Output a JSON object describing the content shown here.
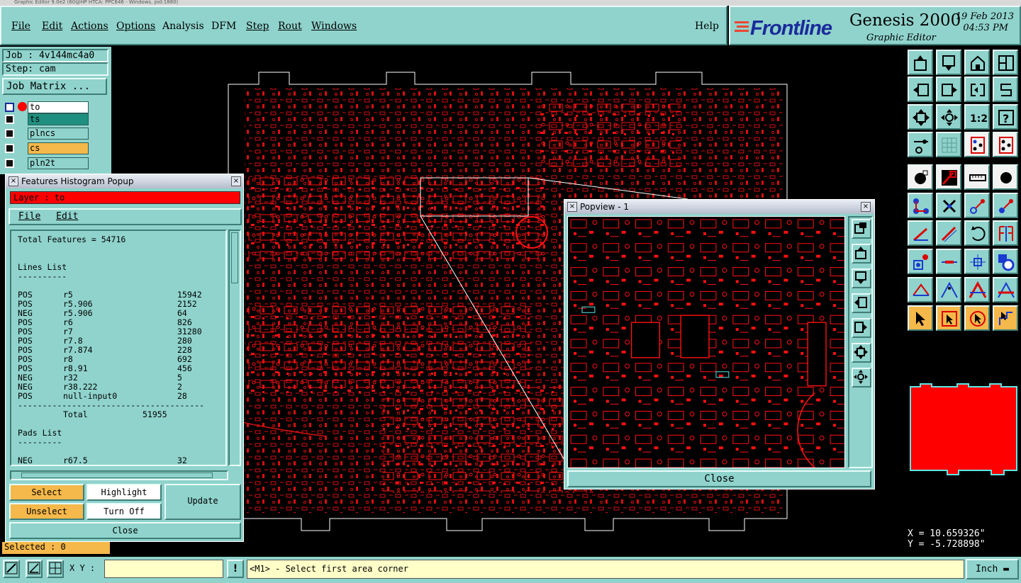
{
  "window": {
    "title": "Graphic Editor 9.0e2 (60@HP HTCA: PPC646 - Windows, pid:1880)"
  },
  "menubar": {
    "items": [
      "File",
      "Edit",
      "Actions",
      "Options",
      "Analysis",
      "DFM",
      "Step",
      "Rout",
      "Windows"
    ],
    "help": "Help"
  },
  "brand": {
    "logo": "Frontline",
    "product": "Genesis 2000",
    "subtitle": "Graphic Editor",
    "date": "19 Feb 2013",
    "time": "04:53 PM"
  },
  "left_panel": {
    "job": "Job : 4v144mc4a0",
    "step": "Step: cam",
    "job_matrix_button": "Job Matrix ...",
    "layers": [
      {
        "name": "to",
        "color": "#ffffff",
        "active": true
      },
      {
        "name": "ts",
        "color": "#1f8f7f",
        "active": false
      },
      {
        "name": "plncs",
        "color": "#8fd3cc",
        "active": false
      },
      {
        "name": "cs",
        "color": "#f5b84a",
        "active": false
      },
      {
        "name": "pln2t",
        "color": "#8fd3cc",
        "active": false
      }
    ]
  },
  "histogram_popup": {
    "title": "Features Histogram Popup",
    "layer_label": "Layer :  to",
    "menu": [
      "File",
      "Edit"
    ],
    "total_features": "Total Features = 54716",
    "lines_header": "Lines List",
    "lines": [
      [
        "POS",
        "r5",
        "15942"
      ],
      [
        "POS",
        "r5.906",
        "2152"
      ],
      [
        "NEG",
        "r5.906",
        "64"
      ],
      [
        "POS",
        "r6",
        "826"
      ],
      [
        "POS",
        "r7",
        "31280"
      ],
      [
        "POS",
        "r7.8",
        "280"
      ],
      [
        "POS",
        "r7.874",
        "228"
      ],
      [
        "POS",
        "r8",
        "692"
      ],
      [
        "POS",
        "r8.91",
        "456"
      ],
      [
        "NEG",
        "r32",
        "5"
      ],
      [
        "NEG",
        "r38.222",
        "2"
      ],
      [
        "POS",
        "null-input0",
        "28"
      ]
    ],
    "total_label": "Total",
    "total_value": "51955",
    "pads_header": "Pads List",
    "pads": [
      [
        "NEG",
        "r67.5",
        "32"
      ]
    ],
    "buttons": {
      "select": "Select",
      "highlight": "Highlight",
      "update": "Update",
      "unselect": "Unselect",
      "turn_off": "Turn Off",
      "close": "Close"
    }
  },
  "popview": {
    "title": "Popview - 1",
    "close": "Close"
  },
  "coords": {
    "x": "X = 10.659326\"",
    "y": "Y = -5.728898\""
  },
  "status": {
    "selected": "Selected : 0",
    "xy_label": "X Y :",
    "xy_value": "",
    "prompt": "<M1> - Select first area corner",
    "units": "Inch"
  },
  "colors": {
    "panel": "#8fd3cc",
    "board": "#ff0000",
    "canvas": "#000000",
    "highlight": "#f5b84a"
  }
}
